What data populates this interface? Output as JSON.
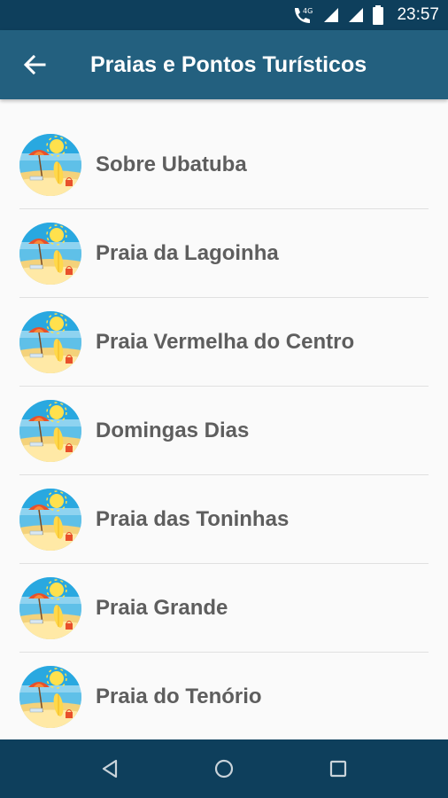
{
  "status_bar": {
    "time": "23:57",
    "network_label": "4G"
  },
  "app_bar": {
    "title": "Praias e Pontos Turísticos"
  },
  "list": {
    "items": [
      {
        "label": "Sobre Ubatuba"
      },
      {
        "label": "Praia da Lagoinha"
      },
      {
        "label": "Praia Vermelha do Centro"
      },
      {
        "label": "Domingas Dias"
      },
      {
        "label": "Praia das Toninhas"
      },
      {
        "label": "Praia Grande"
      },
      {
        "label": "Praia do Tenório"
      }
    ]
  },
  "colors": {
    "status_bar": "#0e3f5c",
    "app_bar": "#23607f",
    "label_text": "#5e5e5e"
  }
}
